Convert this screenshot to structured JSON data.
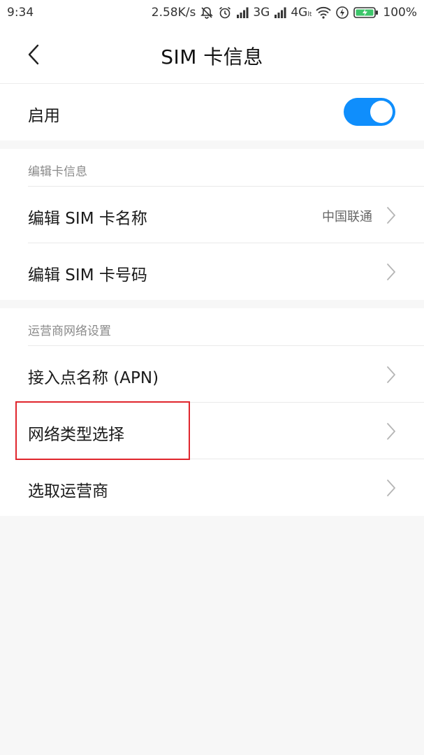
{
  "status_bar": {
    "time": "9:34",
    "net_speed": "2.58K/s",
    "signal1_type": "3G",
    "signal2_type": "4G",
    "signal2_sub": "lt",
    "battery": "100%",
    "icons": [
      "mute-bell-icon",
      "alarm-icon",
      "signal-icon",
      "signal-icon",
      "wifi-icon",
      "flash-icon",
      "battery-charging-icon"
    ]
  },
  "header": {
    "title": "SIM  卡信息",
    "back_icon": "chevron-left-icon"
  },
  "enable_row": {
    "label": "启用",
    "toggle_on": true,
    "accent_color": "#0f8efc"
  },
  "card_info": {
    "section_title": "编辑卡信息",
    "items": [
      {
        "label": "编辑 SIM 卡名称",
        "value": "中国联通"
      },
      {
        "label": "编辑 SIM 卡号码",
        "value": ""
      }
    ]
  },
  "carrier_network": {
    "section_title": "运营商网络设置",
    "items": [
      {
        "label": "接入点名称 (APN)"
      },
      {
        "label": "网络类型选择"
      },
      {
        "label": "选取运营商"
      }
    ]
  },
  "highlight_color": "#e0262d"
}
